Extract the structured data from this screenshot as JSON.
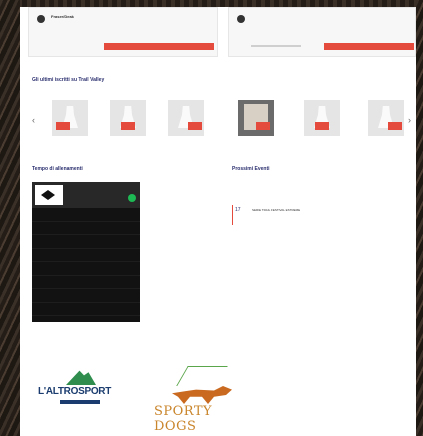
{
  "top_cards": [
    {
      "name": "Fraser/Deak",
      "sub": "",
      "button": ""
    },
    {
      "name": "",
      "sub": "",
      "button": ""
    }
  ],
  "members_section": {
    "title": "Gli ultimi iscritti su Trail Valley",
    "members": [
      "",
      "",
      "",
      "",
      "",
      ""
    ]
  },
  "training_section": {
    "title": "Tempo di allenamenti"
  },
  "spotify": {
    "title": "",
    "subtitle": "",
    "tracks": [
      {
        "n": "",
        "title": "",
        "artist": "",
        "dur": ""
      },
      {
        "n": "",
        "title": "",
        "artist": "",
        "dur": ""
      },
      {
        "n": "",
        "title": "",
        "artist": "",
        "dur": ""
      },
      {
        "n": "",
        "title": "",
        "artist": "",
        "dur": ""
      },
      {
        "n": "",
        "title": "",
        "artist": "",
        "dur": ""
      },
      {
        "n": "",
        "title": "",
        "artist": "",
        "dur": ""
      },
      {
        "n": "",
        "title": "",
        "artist": "",
        "dur": ""
      },
      {
        "n": "",
        "title": "",
        "artist": "",
        "dur": ""
      }
    ]
  },
  "events_section": {
    "title": "Prossimi Eventi",
    "label": "",
    "events": [
      {
        "date": "17",
        "name": "SERIE TRAIL FESTIVAL ESTREME"
      }
    ]
  },
  "partners": {
    "label": "",
    "logo_1": "L'ALTROSPORT",
    "logo_2": "SPORTY DOGS"
  },
  "colors": {
    "accent": "#e54b3c",
    "heading": "#2b2f6e",
    "spotify_green": "#1db954"
  }
}
